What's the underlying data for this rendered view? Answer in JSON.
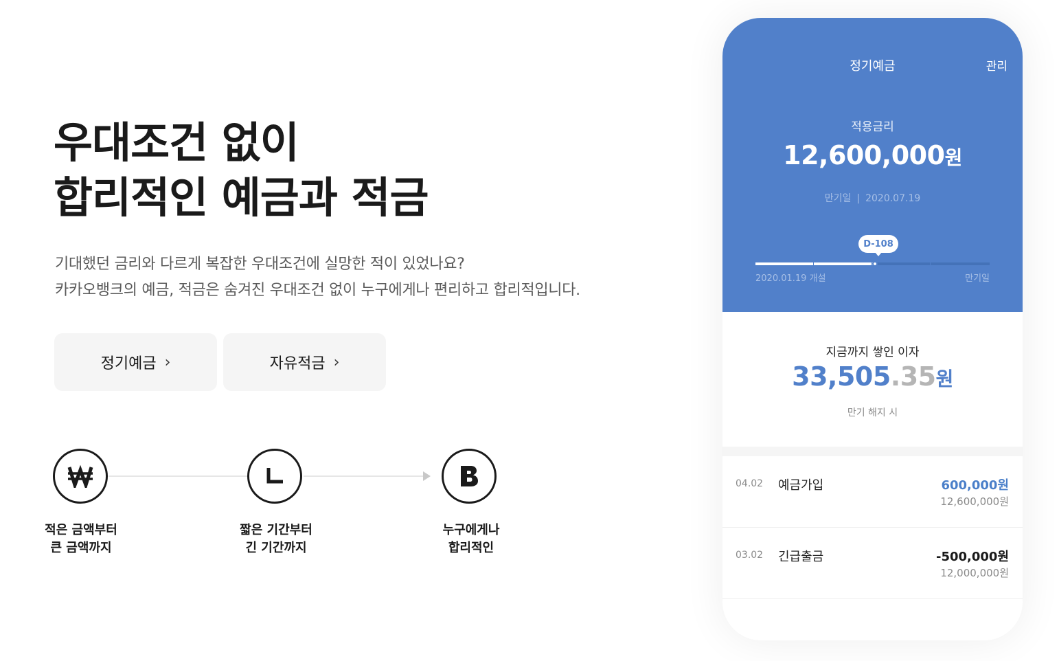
{
  "headline": {
    "line1": "우대조건 없이",
    "line2": "합리적인 예금과 적금"
  },
  "description": {
    "line1": "기대했던 금리와 다르게 복잡한 우대조건에 실망한 적이 있었나요?",
    "line2": "카카오뱅크의 예금, 적금은 숨겨진 우대조건 없이 누구에게나 편리하고 합리적입니다."
  },
  "buttons": [
    {
      "label": "정기예금",
      "chevron": "›"
    },
    {
      "label": "자유적금",
      "chevron": "›"
    }
  ],
  "features": [
    {
      "icon": "won-icon",
      "line1": "적은 금액부터",
      "line2": "큰 금액까지"
    },
    {
      "icon": "clock-icon",
      "line1": "짧은 기간부터",
      "line2": "긴 기간까지"
    },
    {
      "icon": "kakaobank-b-icon",
      "line1": "누구에게나",
      "line2": "합리적인"
    }
  ],
  "phone": {
    "title": "정기예금",
    "manage": "관리",
    "rate_label": "적용금리",
    "balance_number": "12,600,000",
    "balance_unit": "원",
    "maturity_label": "만기일",
    "maturity_sep": "|",
    "maturity_date": "2020.07.19",
    "dday": "D-108",
    "progress": 0.51,
    "track_start": "2020.01.19 개설",
    "track_end": "만기일",
    "interest_label": "지금까지 쌓인 이자",
    "interest_int": "33,505",
    "interest_dec": ".35",
    "interest_unit": "원",
    "interest_note": "만기 해지 시",
    "colors": {
      "primary": "#5180ca",
      "positive": "#4a7fc9"
    },
    "transactions": [
      {
        "date": "04.02",
        "title": "예금가입",
        "amount": "600,000원",
        "balance": "12,600,000원"
      },
      {
        "date": "03.02",
        "title": "긴급출금",
        "amount": "-500,000원",
        "balance": "12,000,000원"
      }
    ]
  }
}
